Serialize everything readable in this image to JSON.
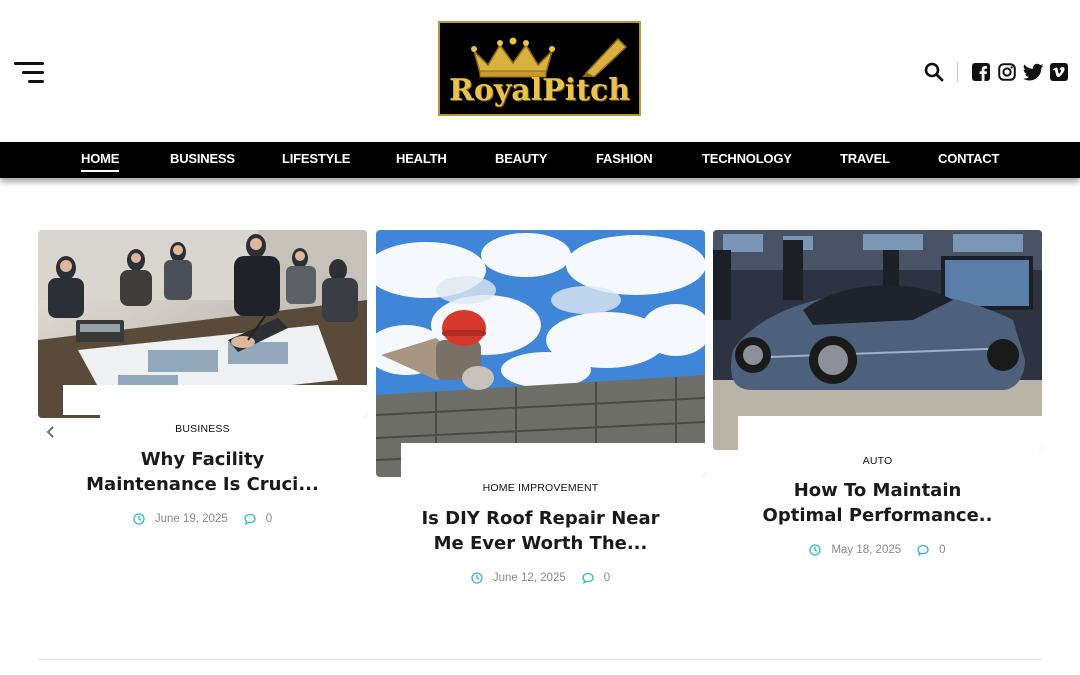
{
  "brand": {
    "logo_text": "RoyalPitch",
    "logo_color": "#e8c24a"
  },
  "nav": {
    "items": [
      {
        "label": "HOME",
        "active": true
      },
      {
        "label": "BUSINESS"
      },
      {
        "label": "LIFESTYLE"
      },
      {
        "label": "HEALTH"
      },
      {
        "label": "BEAUTY"
      },
      {
        "label": "FASHION"
      },
      {
        "label": "TECHNOLOGY"
      },
      {
        "label": "TRAVEL"
      },
      {
        "label": "CONTACT"
      }
    ]
  },
  "header_icons": [
    "search-icon",
    "facebook-icon",
    "instagram-icon",
    "twitter-icon",
    "vimeo-icon"
  ],
  "accent_color": "#2ab7d8",
  "cards": [
    {
      "category": "BUSINESS",
      "title_line1": "Why Facility",
      "title_line2": "Maintenance Is Cruci...",
      "date": "June 19, 2025",
      "comments": "0",
      "image": "business-meeting-image"
    },
    {
      "category": "HOME IMPROVEMENT",
      "title_line1": "Is DIY Roof Repair Near",
      "title_line2": "Me Ever Worth The...",
      "date": "June 12, 2025",
      "comments": "0",
      "image": "roof-worker-image"
    },
    {
      "category": "AUTO",
      "title_line1": "How To Maintain",
      "title_line2": "Optimal Performance..",
      "date": "May 18, 2025",
      "comments": "0",
      "image": "sports-car-image"
    }
  ]
}
